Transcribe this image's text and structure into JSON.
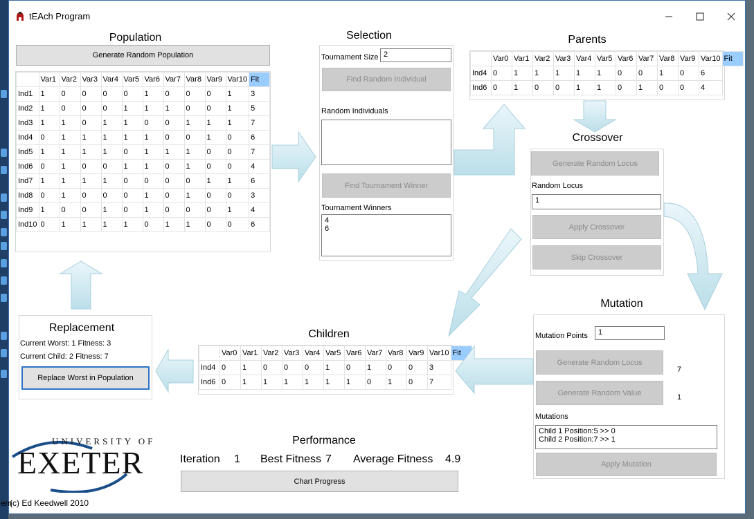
{
  "window": {
    "title": "tEAch Program"
  },
  "population": {
    "heading": "Population",
    "generate_button": "Generate Random Population",
    "columns": [
      "Var1",
      "Var2",
      "Var3",
      "Var4",
      "Var5",
      "Var6",
      "Var7",
      "Var8",
      "Var9",
      "Var10",
      "Fit"
    ],
    "rows": [
      {
        "label": "Ind1",
        "cells": [
          "1",
          "0",
          "0",
          "0",
          "0",
          "1",
          "0",
          "0",
          "0",
          "1",
          "3"
        ]
      },
      {
        "label": "Ind2",
        "cells": [
          "1",
          "0",
          "0",
          "0",
          "1",
          "1",
          "1",
          "0",
          "0",
          "1",
          "5"
        ]
      },
      {
        "label": "Ind3",
        "cells": [
          "1",
          "1",
          "0",
          "1",
          "1",
          "0",
          "0",
          "1",
          "1",
          "1",
          "7"
        ]
      },
      {
        "label": "Ind4",
        "cells": [
          "0",
          "1",
          "1",
          "1",
          "1",
          "1",
          "0",
          "0",
          "1",
          "0",
          "6"
        ]
      },
      {
        "label": "Ind5",
        "cells": [
          "1",
          "1",
          "1",
          "1",
          "0",
          "1",
          "1",
          "1",
          "0",
          "0",
          "7"
        ]
      },
      {
        "label": "Ind6",
        "cells": [
          "0",
          "1",
          "0",
          "0",
          "1",
          "1",
          "0",
          "1",
          "0",
          "0",
          "4"
        ]
      },
      {
        "label": "Ind7",
        "cells": [
          "1",
          "1",
          "1",
          "1",
          "0",
          "0",
          "0",
          "0",
          "1",
          "1",
          "6"
        ]
      },
      {
        "label": "Ind8",
        "cells": [
          "0",
          "1",
          "0",
          "0",
          "0",
          "1",
          "0",
          "1",
          "0",
          "0",
          "3"
        ]
      },
      {
        "label": "Ind9",
        "cells": [
          "1",
          "0",
          "0",
          "1",
          "0",
          "1",
          "0",
          "0",
          "0",
          "1",
          "4"
        ]
      },
      {
        "label": "Ind10",
        "cells": [
          "0",
          "1",
          "1",
          "1",
          "1",
          "0",
          "1",
          "1",
          "0",
          "0",
          "6"
        ]
      }
    ]
  },
  "selection": {
    "heading": "Selection",
    "tournament_size_label": "Tournament Size",
    "tournament_size_value": "2",
    "find_random_button": "Find Random Individual",
    "random_individuals_label": "Random Individuals",
    "random_individuals_value": "",
    "find_winner_button": "Find Tournament Winner",
    "winners_label": "Tournament Winners",
    "winners_value": "4\n6"
  },
  "parents": {
    "heading": "Parents",
    "columns": [
      "Var0",
      "Var1",
      "Var2",
      "Var3",
      "Var4",
      "Var5",
      "Var6",
      "Var7",
      "Var8",
      "Var9",
      "Var10",
      "Fit"
    ],
    "rows": [
      {
        "label": "Ind4",
        "cells": [
          "0",
          "1",
          "1",
          "1",
          "1",
          "1",
          "0",
          "0",
          "1",
          "0",
          "6"
        ]
      },
      {
        "label": "Ind6",
        "cells": [
          "0",
          "1",
          "0",
          "0",
          "1",
          "1",
          "0",
          "1",
          "0",
          "0",
          "4"
        ]
      }
    ]
  },
  "crossover": {
    "heading": "Crossover",
    "generate_locus_button": "Generate Random Locus",
    "random_locus_label": "Random Locus",
    "random_locus_value": "1",
    "apply_button": "Apply Crossover",
    "skip_button": "Skip Crossover"
  },
  "mutation": {
    "heading": "Mutation",
    "points_label": "Mutation Points",
    "points_value": "1",
    "generate_locus_button": "Generate Random Locus",
    "locus_value": "7",
    "generate_value_button": "Generate Random Value",
    "value_value": "1",
    "mutations_label": "Mutations",
    "mutations_value": "Child 1 Position:5 >> 0\nChild 2 Position:7 >> 1",
    "apply_button": "Apply Mutation"
  },
  "children": {
    "heading": "Children",
    "columns": [
      "Var0",
      "Var1",
      "Var2",
      "Var3",
      "Var4",
      "Var5",
      "Var6",
      "Var7",
      "Var8",
      "Var9",
      "Var10",
      "Fit"
    ],
    "rows": [
      {
        "label": "Ind4",
        "cells": [
          "0",
          "1",
          "0",
          "0",
          "0",
          "1",
          "0",
          "1",
          "0",
          "0",
          "3"
        ]
      },
      {
        "label": "Ind6",
        "cells": [
          "0",
          "1",
          "1",
          "1",
          "1",
          "1",
          "1",
          "0",
          "1",
          "0",
          "7"
        ]
      }
    ]
  },
  "replacement": {
    "heading": "Replacement",
    "current_worst": "Current Worst: 1 Fitness: 3",
    "current_child": "Current Child: 2 Fitness: 7",
    "replace_button": "Replace Worst in Population"
  },
  "performance": {
    "heading": "Performance",
    "iteration_label": "Iteration",
    "iteration_value": "1",
    "best_label": "Best Fitness",
    "best_value": "7",
    "avg_label": "Average Fitness",
    "avg_value": "4.9",
    "chart_button": "Chart Progress"
  },
  "logo": {
    "top_text": "UNIVERSITY OF",
    "main_text": "EXETER"
  },
  "copyright": "(c) Ed Keedwell 2010",
  "left_fragment": "em",
  "colors": {
    "fit_header": "#99ccff",
    "arrow_fill": "#d3eaf2",
    "arrow_stroke": "#a8cfdf",
    "focus_border": "#2f73c7"
  }
}
